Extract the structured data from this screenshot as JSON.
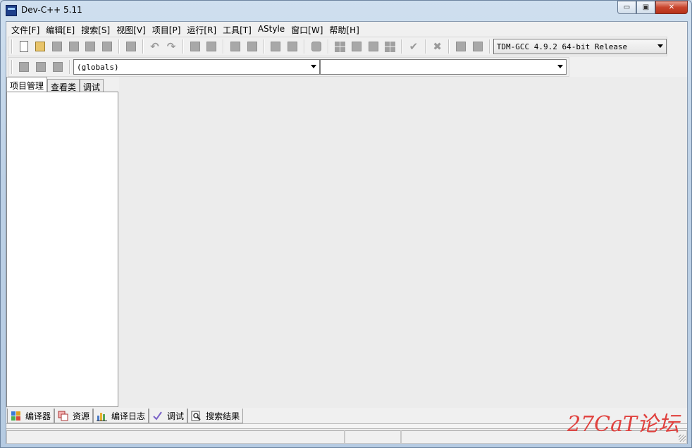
{
  "window": {
    "title": "Dev-C++ 5.11"
  },
  "window_buttons": {
    "minimize": "▭",
    "restore": "▣",
    "close": "✕"
  },
  "menu": [
    "文件[F]",
    "编辑[E]",
    "搜索[S]",
    "视图[V]",
    "项目[P]",
    "运行[R]",
    "工具[T]",
    "AStyle",
    "窗口[W]",
    "帮助[H]"
  ],
  "toolbar": {
    "compiler_select": "TDM-GCC 4.9.2 64-bit Release"
  },
  "class_toolbar": {
    "scope_select": "(globals)",
    "member_select": ""
  },
  "left_tabs": [
    "项目管理",
    "查看类",
    "调试"
  ],
  "bottom_tabs": [
    "编译器",
    "资源",
    "编译日志",
    "调试",
    "搜索结果"
  ],
  "watermark": "27CaT论坛",
  "icons": {
    "undo": "↶",
    "redo": "↷",
    "check": "✔",
    "cross": "✖"
  }
}
